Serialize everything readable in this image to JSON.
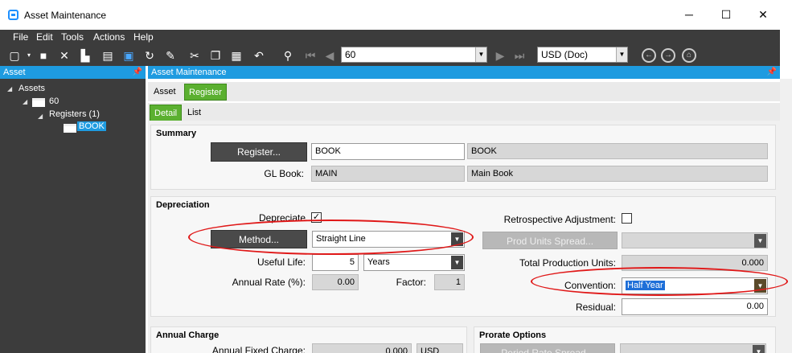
{
  "window": {
    "title": "Asset Maintenance",
    "minimize": "─",
    "maximize": "☐",
    "close": "✕"
  },
  "menu": [
    "File",
    "Edit",
    "Tools",
    "Actions",
    "Help"
  ],
  "toolbar": {
    "record": "60",
    "currency": "USD (Doc)"
  },
  "left_panel": {
    "title": "Asset",
    "tree": {
      "root": "Assets",
      "asset": "60",
      "registers": "Registers (1)",
      "book": "BOOK"
    }
  },
  "right_panel": {
    "title": "Asset Maintenance",
    "tabs": [
      "Asset",
      "Register"
    ],
    "subtabs": [
      "Detail",
      "List"
    ]
  },
  "summary": {
    "header": "Summary",
    "register_button": "Register...",
    "register_id": "BOOK",
    "register_desc": "BOOK",
    "gl_book_label": "GL Book:",
    "gl_book_id": "MAIN",
    "gl_book_desc": "Main Book"
  },
  "depreciation": {
    "header": "Depreciation",
    "depreciate_label": "Depreciate",
    "depreciate_checked": "✓",
    "method_button": "Method...",
    "method_value": "Straight Line",
    "useful_life_label": "Useful Life:",
    "useful_life_value": "5",
    "useful_life_unit": "Years",
    "annual_rate_label": "Annual Rate (%):",
    "annual_rate_value": "0.00",
    "factor_label": "Factor:",
    "factor_value": "1",
    "retro_label": "Retrospective Adjustment:",
    "prod_units_button": "Prod Units Spread...",
    "total_prod_label": "Total Production Units:",
    "total_prod_value": "0.000",
    "convention_label": "Convention:",
    "convention_value": "Half Year",
    "residual_label": "Residual:",
    "residual_value": "0.00"
  },
  "annual_charge": {
    "header": "Annual Charge",
    "fixed_label": "Annual Fixed Charge:",
    "fixed_value": "0.000",
    "currency": "USD"
  },
  "prorate": {
    "header": "Prorate Options",
    "button": "Period Rate Spread..."
  }
}
